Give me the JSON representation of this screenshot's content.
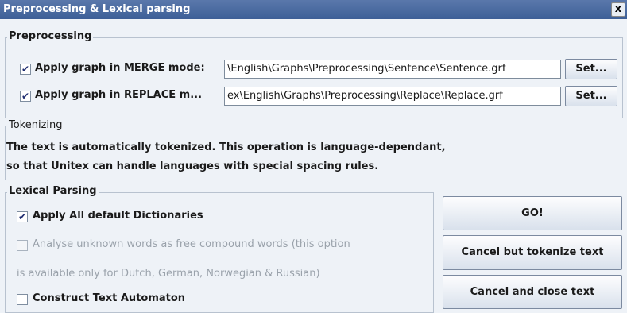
{
  "window": {
    "title": "Preprocessing & Lexical parsing",
    "close_label": "x"
  },
  "preprocessing": {
    "legend": "Preprocessing",
    "merge": {
      "checked": true,
      "check_glyph": "✔",
      "label": "Apply graph in MERGE mode:",
      "path": "\\English\\Graphs\\Preprocessing\\Sentence\\Sentence.grf",
      "set_label": "Set..."
    },
    "replace": {
      "checked": true,
      "check_glyph": "✔",
      "label": "Apply graph in REPLACE m...",
      "path": "ex\\English\\Graphs\\Preprocessing\\Replace\\Replace.grf",
      "set_label": "Set..."
    }
  },
  "tokenizing": {
    "legend": "Tokenizing",
    "line1": "The text is automatically tokenized. This operation is language-dependant,",
    "line2": "so that Unitex can handle languages with special spacing rules."
  },
  "lexical": {
    "legend": "Lexical Parsing",
    "all_dicts": {
      "checked": true,
      "check_glyph": "✔",
      "label": "Apply All default Dictionaries"
    },
    "unknown_words": {
      "checked": false,
      "enabled": false,
      "label1": "Analyse unknown words as free compound words (this option",
      "label2": "is available only for Dutch, German, Norwegian & Russian)"
    },
    "automaton": {
      "checked": false,
      "label": "Construct Text Automaton"
    }
  },
  "actions": {
    "go": "GO!",
    "cancel_tokenize": "Cancel but tokenize text",
    "cancel_close": "Cancel and close text"
  }
}
